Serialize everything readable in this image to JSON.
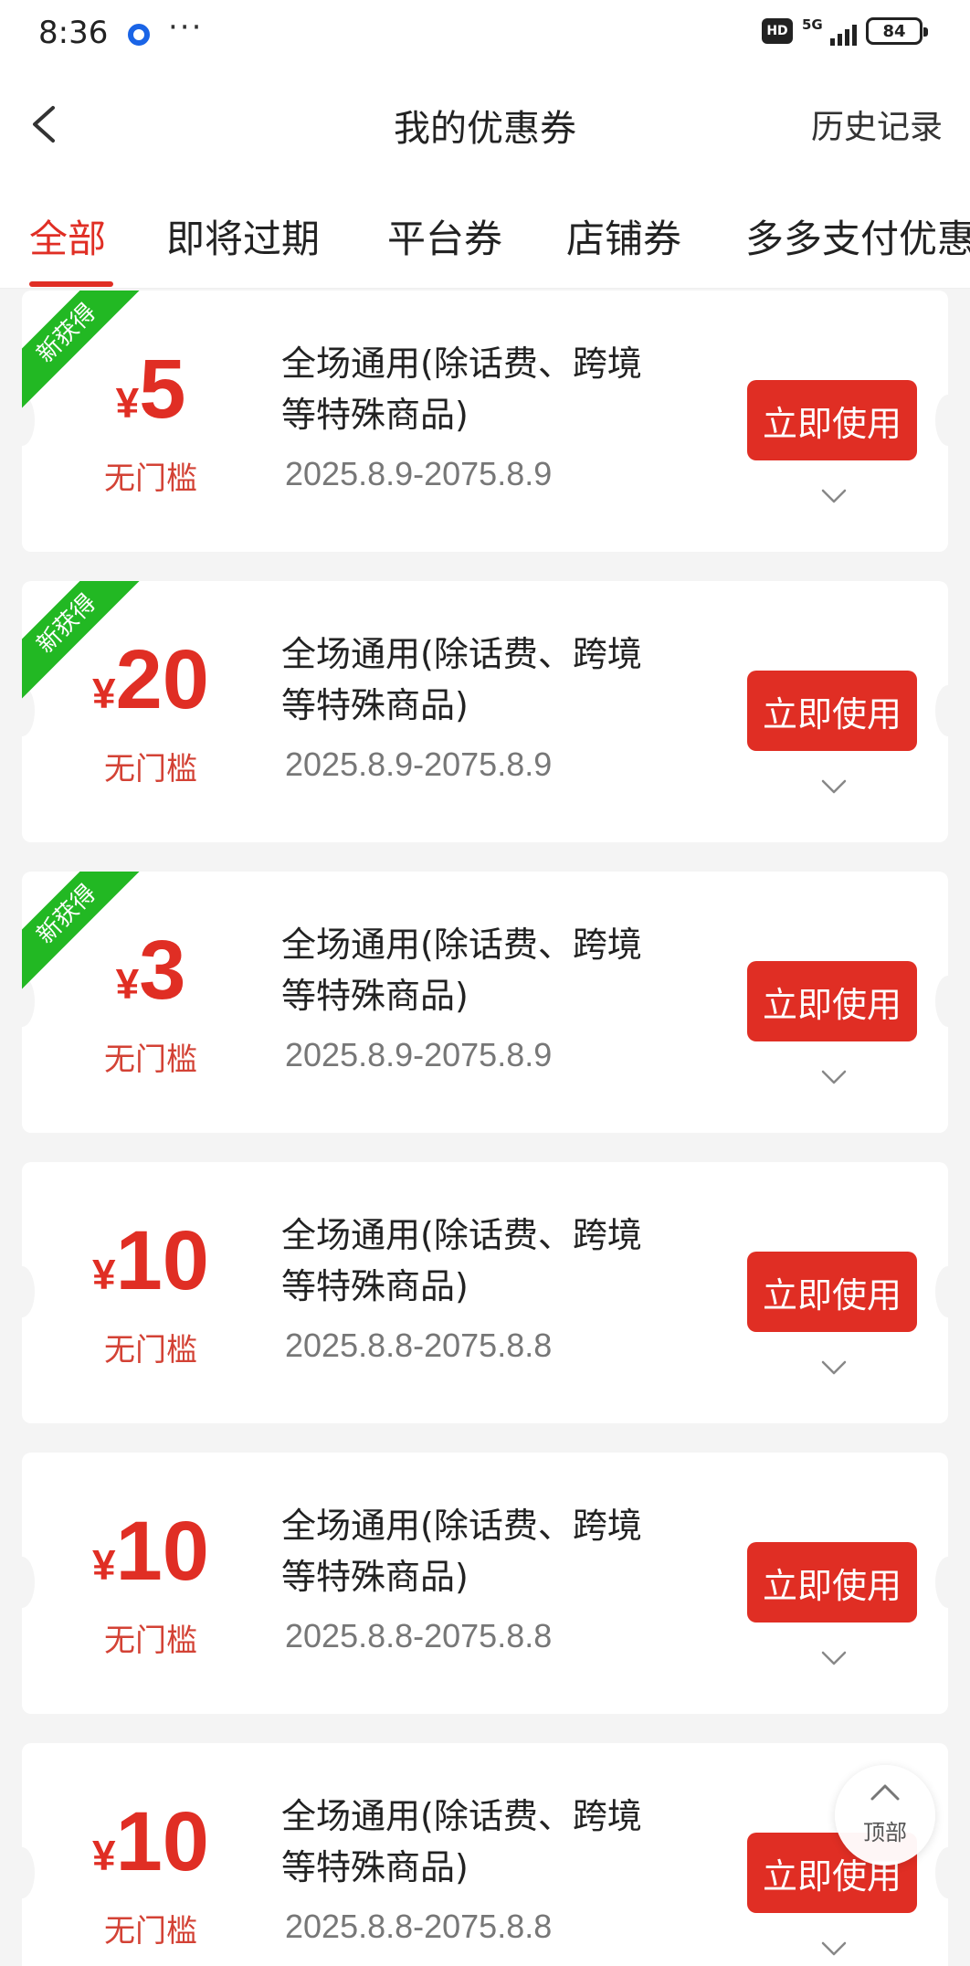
{
  "status_bar": {
    "time": "8:36",
    "more": "···",
    "hd_label": "HD",
    "network": "5G",
    "battery": "84"
  },
  "nav": {
    "title": "我的优惠券",
    "history": "历史记录"
  },
  "tabs": [
    "全部",
    "即将过期",
    "平台券",
    "店铺券",
    "多多支付优惠"
  ],
  "coupons": [
    {
      "is_new": true,
      "new_label": "新获得",
      "currency": "¥",
      "amount": "5",
      "threshold": "无门槛",
      "title": "全场通用(除话费、跨境等特殊商品)",
      "date": "2025.8.9-2075.8.9",
      "button": "立即使用"
    },
    {
      "is_new": true,
      "new_label": "新获得",
      "currency": "¥",
      "amount": "20",
      "threshold": "无门槛",
      "title": "全场通用(除话费、跨境等特殊商品)",
      "date": "2025.8.9-2075.8.9",
      "button": "立即使用"
    },
    {
      "is_new": true,
      "new_label": "新获得",
      "currency": "¥",
      "amount": "3",
      "threshold": "无门槛",
      "title": "全场通用(除话费、跨境等特殊商品)",
      "date": "2025.8.9-2075.8.9",
      "button": "立即使用"
    },
    {
      "is_new": false,
      "new_label": "",
      "currency": "¥",
      "amount": "10",
      "threshold": "无门槛",
      "title": "全场通用(除话费、跨境等特殊商品)",
      "date": "2025.8.8-2075.8.8",
      "button": "立即使用"
    },
    {
      "is_new": false,
      "new_label": "",
      "currency": "¥",
      "amount": "10",
      "threshold": "无门槛",
      "title": "全场通用(除话费、跨境等特殊商品)",
      "date": "2025.8.8-2075.8.8",
      "button": "立即使用"
    },
    {
      "is_new": false,
      "new_label": "",
      "currency": "¥",
      "amount": "10",
      "threshold": "无门槛",
      "title": "全场通用(除话费、跨境等特殊商品)",
      "date": "2025.8.8-2075.8.8",
      "button": "立即使用"
    }
  ],
  "back_to_top": "顶部",
  "colors": {
    "accent": "#e02e24",
    "new_badge": "#22b823",
    "background": "#f4f4f4"
  }
}
